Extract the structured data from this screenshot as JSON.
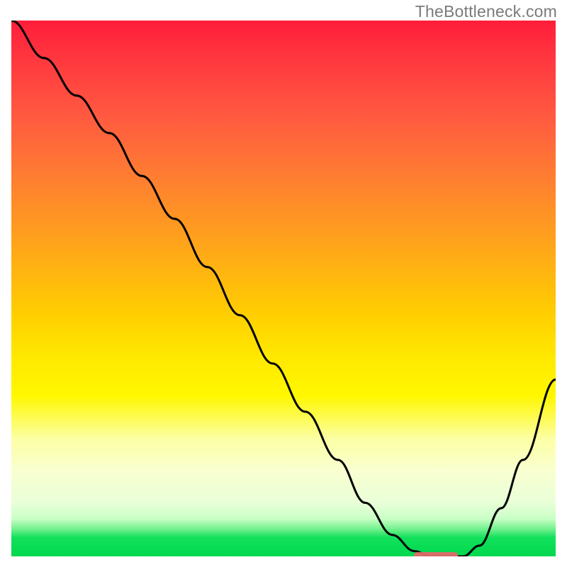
{
  "watermark": "TheBottleneck.com",
  "chart_data": {
    "type": "line",
    "title": "",
    "xlabel": "",
    "ylabel": "",
    "xlim": [
      0,
      100
    ],
    "ylim": [
      0,
      100
    ],
    "x": [
      0,
      6,
      12,
      18,
      24,
      30,
      36,
      42,
      48,
      54,
      60,
      65,
      70,
      74,
      77,
      80,
      83,
      86,
      90,
      94,
      100
    ],
    "values": [
      100,
      93,
      86,
      79,
      71,
      63,
      54,
      45,
      36,
      27,
      18,
      10,
      4,
      1,
      0,
      0,
      0,
      2,
      9,
      18,
      33
    ],
    "minimum_band": {
      "x_start": 74,
      "x_end": 82,
      "y": 0
    },
    "gradient_stops": [
      {
        "pos": 0.0,
        "color": "#ff1d3a"
      },
      {
        "pos": 0.3,
        "color": "#ff8030"
      },
      {
        "pos": 0.55,
        "color": "#ffcf00"
      },
      {
        "pos": 0.78,
        "color": "#fcffa4"
      },
      {
        "pos": 0.93,
        "color": "#c9ffc6"
      },
      {
        "pos": 1.0,
        "color": "#00d84e"
      }
    ]
  },
  "marker_color": "#e06a6a"
}
